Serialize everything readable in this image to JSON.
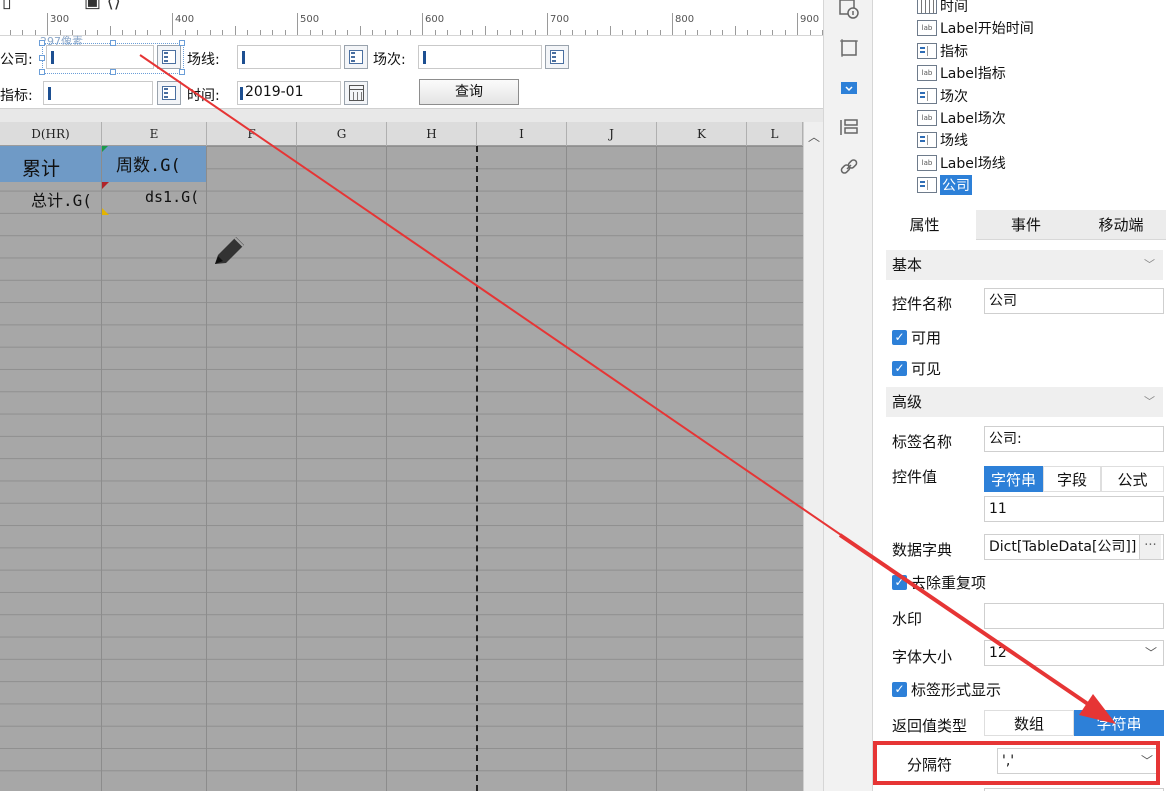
{
  "ruler": {
    "ticks": [
      "300",
      "400",
      "500",
      "600",
      "700",
      "800",
      "900"
    ]
  },
  "form": {
    "company_label": "公司:",
    "line_label": "场线:",
    "session_label": "场次:",
    "metric_label": "指标:",
    "time_label": "时间:",
    "time_value": "2019-01",
    "query_button": "查询",
    "pixel_hint": "297像素"
  },
  "sheet": {
    "columns": [
      "D(HR)",
      "E",
      "F",
      "G",
      "H",
      "I",
      "J",
      "K",
      "L"
    ],
    "cells": {
      "d1": "累计",
      "e1": "周数.G(",
      "d2": "总计.G(",
      "e2": "ds1.G("
    }
  },
  "tree": {
    "items": [
      {
        "label": "时间",
        "kind": "grid"
      },
      {
        "label": "Label开始时间",
        "kind": "label"
      },
      {
        "label": "指标",
        "kind": "widget"
      },
      {
        "label": "Label指标",
        "kind": "label"
      },
      {
        "label": "场次",
        "kind": "widget"
      },
      {
        "label": "Label场次",
        "kind": "label"
      },
      {
        "label": "场线",
        "kind": "widget"
      },
      {
        "label": "Label场线",
        "kind": "label"
      },
      {
        "label": "公司",
        "kind": "widget",
        "selected": true
      }
    ],
    "label_icon_text": "lab"
  },
  "tabs": [
    "属性",
    "事件",
    "移动端"
  ],
  "props": {
    "basic_section": "基本",
    "name_label": "控件名称",
    "name_value": "公司",
    "enabled_label": "可用",
    "visible_label": "可见",
    "advanced_section": "高级",
    "tag_label": "标签名称",
    "tag_value": "公司:",
    "value_label": "控件值",
    "value_modes": [
      "字符串",
      "字段",
      "公式"
    ],
    "value_input": "11",
    "dict_label": "数据字典",
    "dict_value": "Dict[TableData[公司]]",
    "dedupe_label": "去除重复项",
    "watermark_label": "水印",
    "font_size_label": "字体大小",
    "font_size_value": "12",
    "tag_display_label": "标签形式显示",
    "return_type_label": "返回值类型",
    "return_types": [
      "数组",
      "字符串"
    ],
    "separator_label": "分隔符",
    "separator_value": "','"
  },
  "colors": {
    "accent": "#2d80d8",
    "annotation": "#e63535",
    "cell_highlight": "#6f9ac6",
    "grid": "#a7a7a7"
  }
}
